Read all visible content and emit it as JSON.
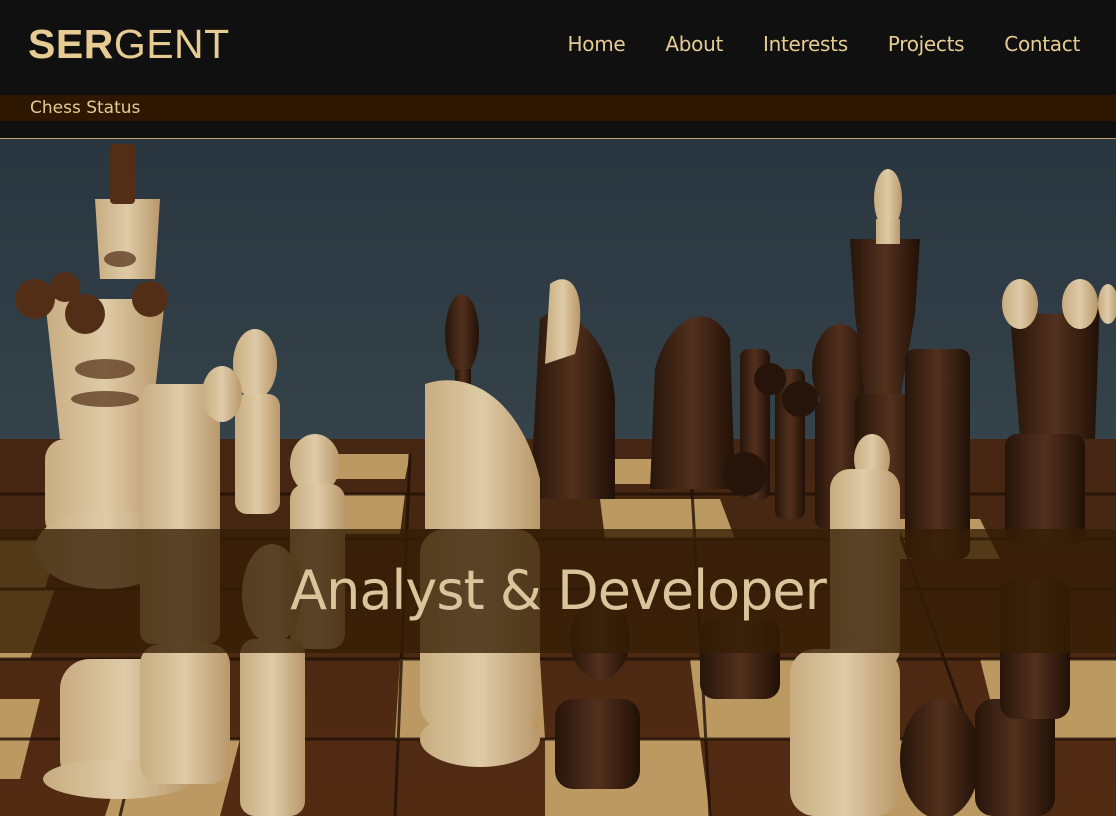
{
  "header": {
    "logo_bold": "SER",
    "logo_light": "GENT",
    "nav": [
      {
        "label": "Home"
      },
      {
        "label": "About"
      },
      {
        "label": "Interests"
      },
      {
        "label": "Projects"
      },
      {
        "label": "Contact"
      }
    ]
  },
  "subheader": {
    "label": "Chess Status"
  },
  "hero": {
    "image_subject": "chess pieces on a wooden board",
    "banner_text": "Analyst & Developer"
  },
  "colors": {
    "accent": "#e6cb93",
    "header_bg": "#101010",
    "subbar_bg": "#2e1700",
    "banner_overlay": "#341e04"
  }
}
